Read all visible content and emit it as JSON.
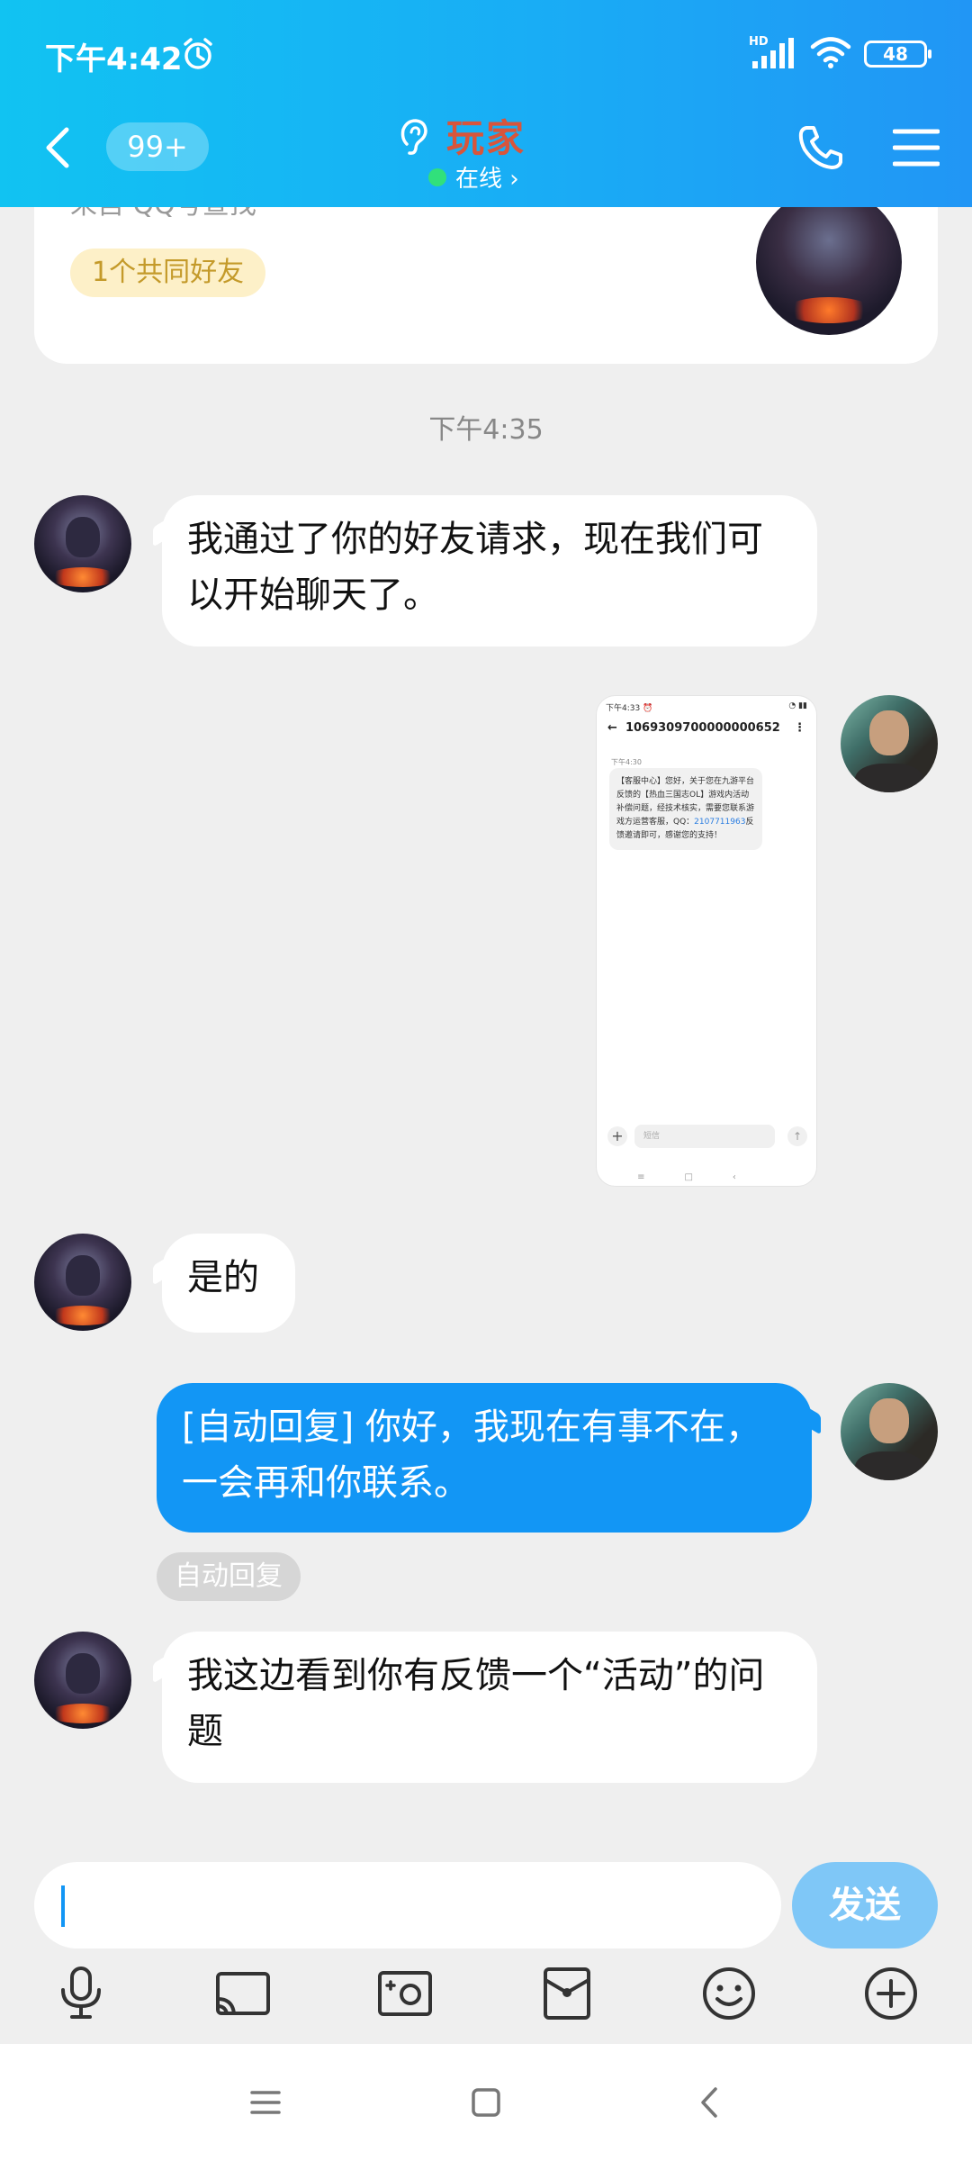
{
  "status_bar": {
    "time": "下午4:42",
    "network": "HD",
    "battery": "48"
  },
  "header": {
    "unread_badge": "99+",
    "title": "玩家",
    "online_status": "在线 ›"
  },
  "profile_card": {
    "partial_text": "来自 QQ号查找",
    "mutual_friends": "1个共同好友"
  },
  "chat": {
    "timestamp": "下午4:35",
    "messages": [
      {
        "sender": "other",
        "text": "我通过了你的好友请求，现在我们可以开始聊天了。"
      },
      {
        "sender": "me",
        "type": "image"
      },
      {
        "sender": "other",
        "text": "是的"
      },
      {
        "sender": "me",
        "text": "[自动回复] 你好，我现在有事不在，一会再和你联系。"
      },
      {
        "sender": "other",
        "text": "我这边看到你有反馈一个“活动”的问题"
      }
    ],
    "auto_reply_tag": "自动回复"
  },
  "screenshot": {
    "status_time": "下午4:33 ⏰",
    "status_right": "◔ ▮▮",
    "sender_number": "1069309700000000652",
    "time": "下午4:30",
    "message_part1": "【客服中心】您好，关于您在九游平台反馈的【热血三国志OL】游戏内活动补偿问题，经技术核实，需要您联系游戏方运营客服，QQ：",
    "qq_number": "2107711963",
    "message_part2": "反馈邀请即可，感谢您的支持！",
    "input_placeholder": "短信"
  },
  "input": {
    "send_label": "发送"
  },
  "colors": {
    "header_start": "#11c3f2",
    "header_end": "#2196f5",
    "title": "#d8553b",
    "my_bubble": "#1296f5",
    "send_button": "#7fc7f7",
    "online_dot": "#31e07b"
  }
}
